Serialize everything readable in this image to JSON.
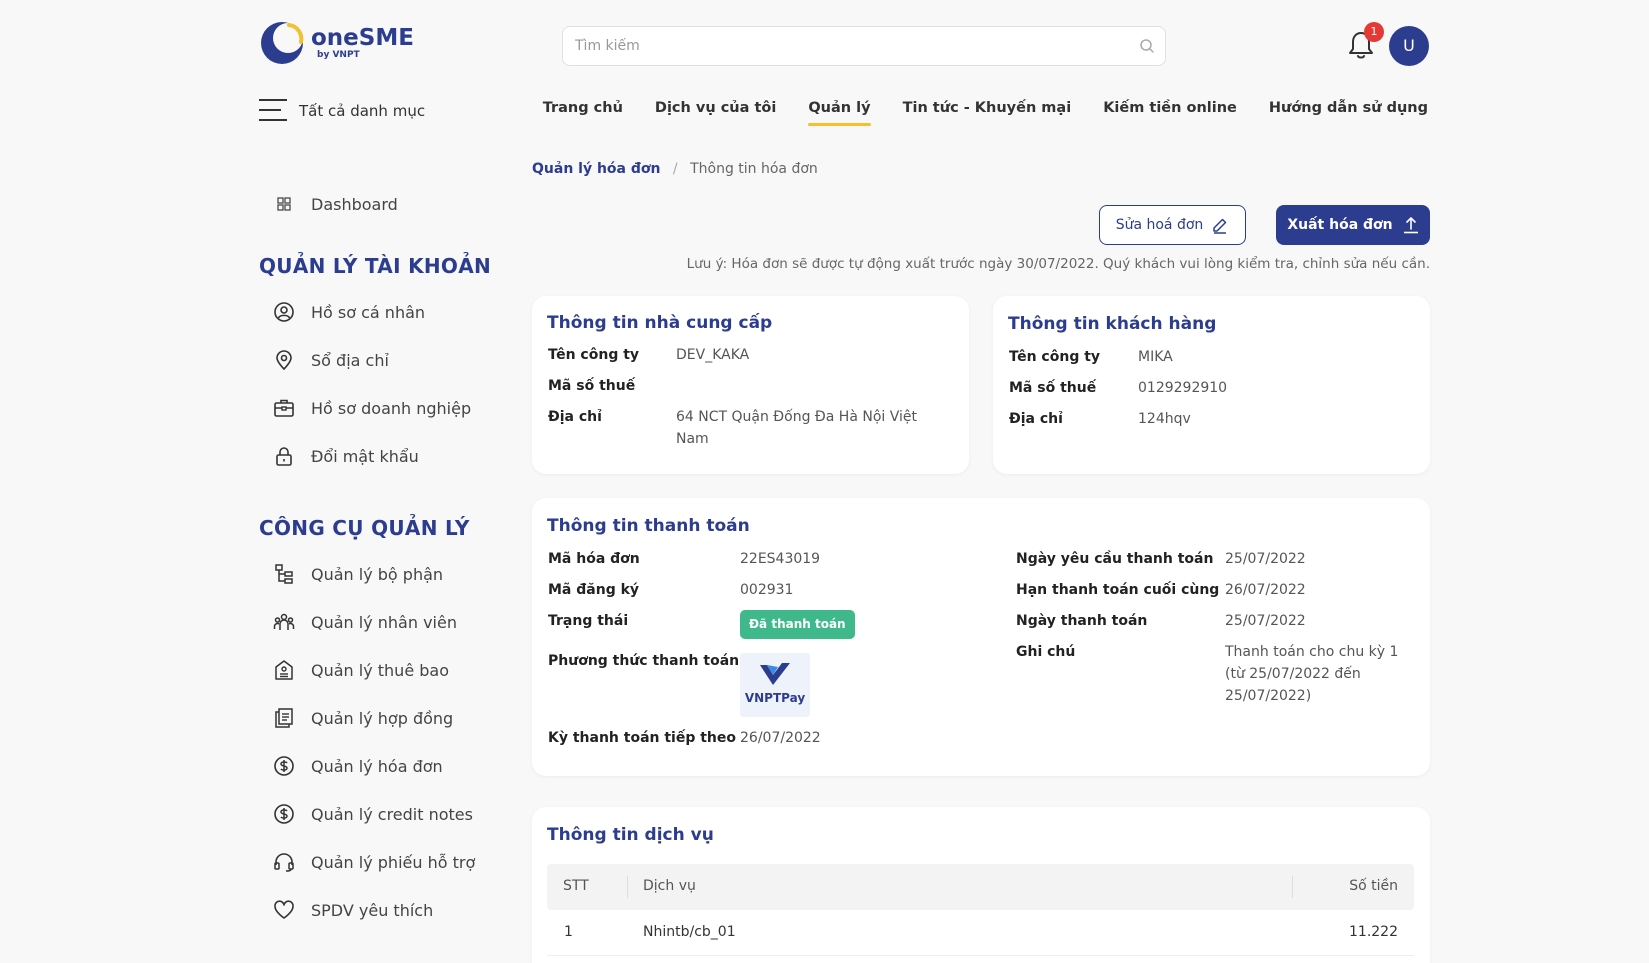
{
  "brand": {
    "name": "oneSME",
    "sub": "by VNPT"
  },
  "search": {
    "placeholder": "Tìm kiếm"
  },
  "notifications": {
    "count": "1"
  },
  "user": {
    "initial": "U"
  },
  "category_menu": {
    "label": "Tất cả danh mục"
  },
  "nav": {
    "items": [
      {
        "label": "Trang chủ"
      },
      {
        "label": "Dịch vụ của tôi"
      },
      {
        "label": "Quản lý"
      },
      {
        "label": "Tin tức - Khuyến mại"
      },
      {
        "label": "Kiếm tiền online"
      },
      {
        "label": "Hướng dẫn sử dụng"
      }
    ],
    "active_index": 2,
    "active_color": "#f3c02f"
  },
  "sidebar": {
    "dashboard": {
      "label": "Dashboard",
      "icon": "grid-icon"
    },
    "account_heading": "QUẢN LÝ TÀI KHOẢN",
    "account_items": [
      {
        "label": "Hồ sơ cá nhân",
        "icon": "user-circle-icon"
      },
      {
        "label": "Sổ địa chỉ",
        "icon": "map-pin-icon"
      },
      {
        "label": "Hồ sơ doanh nghiệp",
        "icon": "briefcase-icon"
      },
      {
        "label": "Đổi mật khẩu",
        "icon": "lock-icon"
      }
    ],
    "tools_heading": "CÔNG CỤ QUẢN LÝ",
    "tools_items": [
      {
        "label": "Quản lý bộ phận",
        "icon": "org-chart-icon"
      },
      {
        "label": "Quản lý nhân viên",
        "icon": "users-icon"
      },
      {
        "label": "Quản lý thuê bao",
        "icon": "subscription-icon"
      },
      {
        "label": "Quản lý hợp đồng",
        "icon": "contract-icon"
      },
      {
        "label": "Quản lý hóa đơn",
        "icon": "dollar-circle-icon"
      },
      {
        "label": "Quản lý credit notes",
        "icon": "credit-note-icon"
      },
      {
        "label": "Quản lý phiếu hỗ trợ",
        "icon": "headset-icon"
      },
      {
        "label": "SPDV yêu thích",
        "icon": "heart-icon"
      }
    ]
  },
  "breadcrumb": {
    "parent": "Quản lý hóa đơn",
    "separator": "/",
    "current": "Thông tin hóa đơn"
  },
  "actions": {
    "edit_label": "Sửa hoá đơn",
    "export_label": "Xuất hóa đơn"
  },
  "note": "Lưu ý: Hóa đơn sẽ được tự động xuất trước ngày 30/07/2022. Quý khách vui lòng kiểm tra, chỉnh sửa nếu cần.",
  "supplier": {
    "title": "Thông tin nhà cung cấp",
    "company_label": "Tên công ty",
    "company": "DEV_KAKA",
    "tax_label": "Mã số thuế",
    "tax": "",
    "address_label": "Địa chỉ",
    "address": "64 NCT Quận Đống Đa Hà Nội Việt Nam"
  },
  "customer": {
    "title": "Thông tin khách hàng",
    "company_label": "Tên công ty",
    "company": "MIKA",
    "tax_label": "Mã số thuế",
    "tax": "0129292910",
    "address_label": "Địa chỉ",
    "address": "124hqv"
  },
  "payment": {
    "title": "Thông tin thanh toán",
    "invoice_code_label": "Mã hóa đơn",
    "invoice_code": "22ES43019",
    "reg_code_label": "Mã đăng ký",
    "reg_code": "002931",
    "status_label": "Trạng thái",
    "status": "Đã thanh toán",
    "status_color": "#3fb98b",
    "method_label": "Phương thức thanh toán",
    "method_logo_text": "VNPTPay",
    "next_period_label": "Kỳ thanh toán tiếp theo",
    "next_period": "26/07/2022",
    "request_date_label": "Ngày yêu cầu thanh toán",
    "request_date": "25/07/2022",
    "deadline_label": "Hạn thanh toán cuối cùng",
    "deadline": "26/07/2022",
    "paid_date_label": "Ngày thanh toán",
    "paid_date": "25/07/2022",
    "note_label": "Ghi chú",
    "note_value": "Thanh toán cho chu kỳ 1 (từ 25/07/2022 đến 25/07/2022)"
  },
  "service": {
    "title": "Thông tin dịch vụ",
    "columns": {
      "stt": "STT",
      "service": "Dịch vụ",
      "amount": "Số tiền"
    },
    "rows": [
      {
        "stt": "1",
        "service": "Nhintb/cb_01",
        "amount": "11.222"
      }
    ]
  },
  "colors": {
    "brand": "#2c3d8f",
    "accent": "#f3c02f",
    "success": "#3fb98b",
    "badge": "#e53935"
  }
}
